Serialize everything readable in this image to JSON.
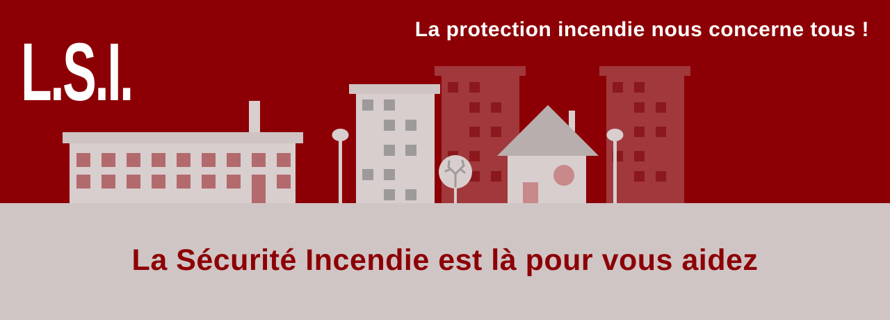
{
  "banner": {
    "logo_text": "L.S.I.",
    "tagline": "La protection incendie nous concerne tous !",
    "headline": "La Sécurité Incendie est là pour vous aidez"
  },
  "colors": {
    "brand_red": "#8c0005",
    "ground": "#d0c5c5",
    "building_light": "#d8cece",
    "building_faded": "#b25a5d",
    "text_white": "#ffffff"
  },
  "icons": [
    "lsi-logo",
    "factory-building",
    "apartment-tower",
    "house",
    "street-lamp",
    "tree"
  ]
}
